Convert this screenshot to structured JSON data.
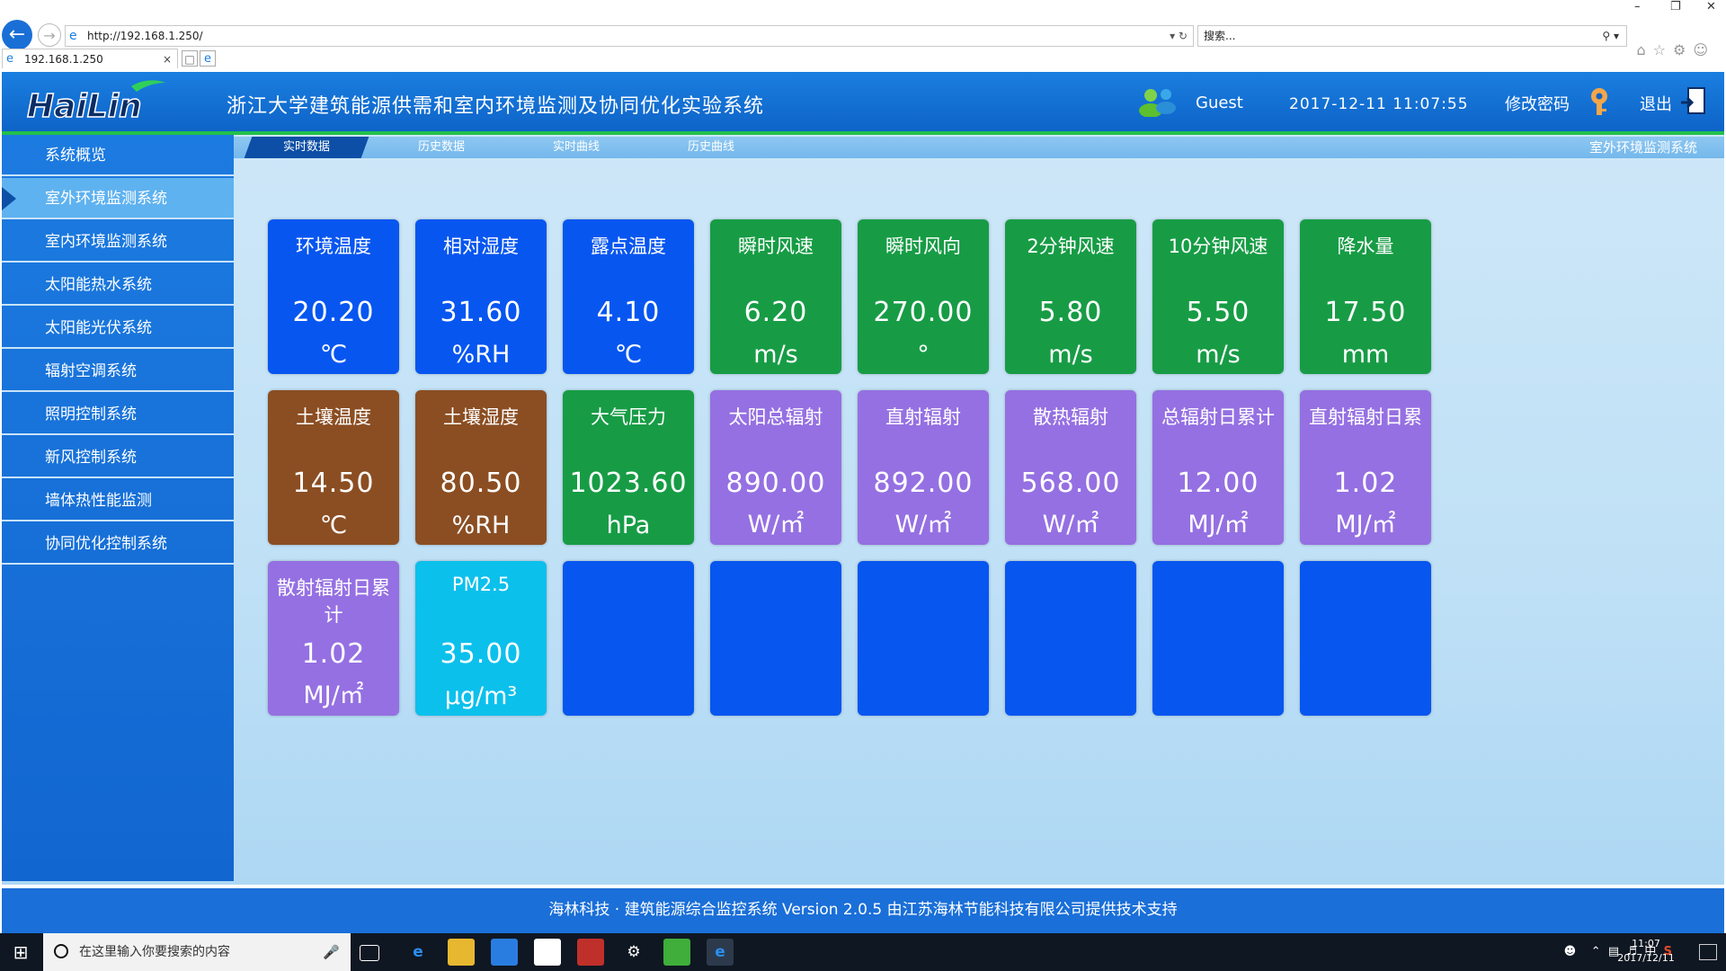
{
  "browser": {
    "url": "http://192.168.1.250/",
    "search_placeholder": "搜索...",
    "tab_title": "192.168.1.250",
    "win_min": "–",
    "win_max": "❐",
    "win_close": "✕"
  },
  "header": {
    "logo_text": "HaiLin",
    "title": "浙江大学建筑能源供需和室内环境监测及协同优化实验系统",
    "user": "Guest",
    "datetime": "2017-12-11  11:07:55",
    "change_password": "修改密码",
    "logout": "退出"
  },
  "sidebar": {
    "items": [
      {
        "label": "系统概览"
      },
      {
        "label": "室外环境监测系统"
      },
      {
        "label": "室内环境监测系统"
      },
      {
        "label": "太阳能热水系统"
      },
      {
        "label": "太阳能光伏系统"
      },
      {
        "label": "辐射空调系统"
      },
      {
        "label": "照明控制系统"
      },
      {
        "label": "新风控制系统"
      },
      {
        "label": "墙体热性能监测"
      },
      {
        "label": "协同优化控制系统"
      }
    ],
    "active_index": 1
  },
  "subtabs": {
    "items": [
      {
        "label": "实时数据"
      },
      {
        "label": "历史数据"
      },
      {
        "label": "实时曲线"
      },
      {
        "label": "历史曲线"
      }
    ],
    "section_label": "室外环境监测系统"
  },
  "colors": {
    "blue": "#0756f0",
    "green": "#179c45",
    "brown": "#8b4e22",
    "purple": "#9570e2",
    "cyan": "#0cc0ec",
    "empty": "#0756f0"
  },
  "cards": [
    {
      "name": "环境温度",
      "value": "20.20",
      "unit": "℃",
      "color": "#0756f0"
    },
    {
      "name": "相对湿度",
      "value": "31.60",
      "unit": "%RH",
      "color": "#0756f0"
    },
    {
      "name": "露点温度",
      "value": "4.10",
      "unit": "℃",
      "color": "#0756f0"
    },
    {
      "name": "瞬时风速",
      "value": "6.20",
      "unit": "m/s",
      "color": "#179c45"
    },
    {
      "name": "瞬时风向",
      "value": "270.00",
      "unit": "°",
      "color": "#179c45"
    },
    {
      "name": "2分钟风速",
      "value": "5.80",
      "unit": "m/s",
      "color": "#179c45"
    },
    {
      "name": "10分钟风速",
      "value": "5.50",
      "unit": "m/s",
      "color": "#179c45"
    },
    {
      "name": "降水量",
      "value": "17.50",
      "unit": "mm",
      "color": "#179c45"
    },
    {
      "name": "土壤温度",
      "value": "14.50",
      "unit": "℃",
      "color": "#8b4e22"
    },
    {
      "name": "土壤湿度",
      "value": "80.50",
      "unit": "%RH",
      "color": "#8b4e22"
    },
    {
      "name": "大气压力",
      "value": "1023.60",
      "unit": "hPa",
      "color": "#179c45"
    },
    {
      "name": "太阳总辐射",
      "value": "890.00",
      "unit": "W/㎡",
      "color": "#9570e2"
    },
    {
      "name": "直射辐射",
      "value": "892.00",
      "unit": "W/㎡",
      "color": "#9570e2"
    },
    {
      "name": "散热辐射",
      "value": "568.00",
      "unit": "W/㎡",
      "color": "#9570e2"
    },
    {
      "name": "总辐射日累计",
      "value": "12.00",
      "unit": "MJ/㎡",
      "color": "#9570e2"
    },
    {
      "name": "直射辐射日累",
      "value": "1.02",
      "unit": "MJ/㎡",
      "color": "#9570e2"
    },
    {
      "name": "散射辐射日累计",
      "value": "1.02",
      "unit": "MJ/㎡",
      "color": "#9570e2"
    },
    {
      "name": "PM2.5",
      "value": "35.00",
      "unit": "μg/m³",
      "color": "#0cc0ec"
    },
    {
      "name": "",
      "value": "",
      "unit": "",
      "color": "#0756f0"
    },
    {
      "name": "",
      "value": "",
      "unit": "",
      "color": "#0756f0"
    },
    {
      "name": "",
      "value": "",
      "unit": "",
      "color": "#0756f0"
    },
    {
      "name": "",
      "value": "",
      "unit": "",
      "color": "#0756f0"
    },
    {
      "name": "",
      "value": "",
      "unit": "",
      "color": "#0756f0"
    },
    {
      "name": "",
      "value": "",
      "unit": "",
      "color": "#0756f0"
    }
  ],
  "footer": {
    "text": "海林科技 · 建筑能源综合监控系统 Version 2.0.5 由江苏海林节能科技有限公司提供技术支持"
  },
  "taskbar": {
    "search_placeholder": "在这里输入你要搜索的内容",
    "clock_time": "11:07",
    "clock_date": "2017/12/11",
    "ime": "中"
  }
}
